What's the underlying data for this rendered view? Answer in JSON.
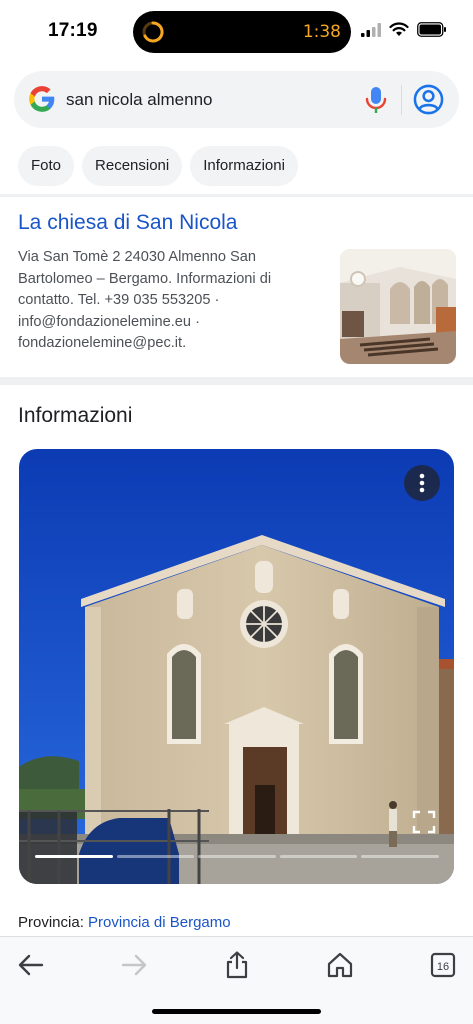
{
  "status": {
    "time": "17:19",
    "timer": "1:38",
    "icons": [
      "signal-icon",
      "wifi-icon",
      "battery-icon"
    ]
  },
  "search": {
    "query": "san nicola almenno",
    "icons": [
      "google-logo-icon",
      "microphone-icon",
      "account-icon"
    ]
  },
  "chips": [
    "Foto",
    "Recensioni",
    "Informazioni"
  ],
  "result": {
    "title": "La chiesa di San Nicola",
    "snippet": "Via San Tomè 2 24030 Almenno San Bartolomeo – Bergamo. Informazioni di contatto. Tel. +39 035 553205 · info@fondazionelemine.eu · fondazionelemine@pec.it."
  },
  "info": {
    "heading": "Informazioni",
    "gallery_segments": 5,
    "gallery_active_index": 0
  },
  "provincia": {
    "label": "Provincia: ",
    "value": "Provincia di Bergamo"
  },
  "toolbar": {
    "buttons": [
      "back-arrow-icon",
      "forward-arrow-icon",
      "share-icon",
      "home-icon",
      "tabs-icon"
    ],
    "tab_count": "16"
  },
  "colors": {
    "link": "#1a55c8",
    "sky": "#0d3fbf",
    "timer": "#f5a623"
  }
}
